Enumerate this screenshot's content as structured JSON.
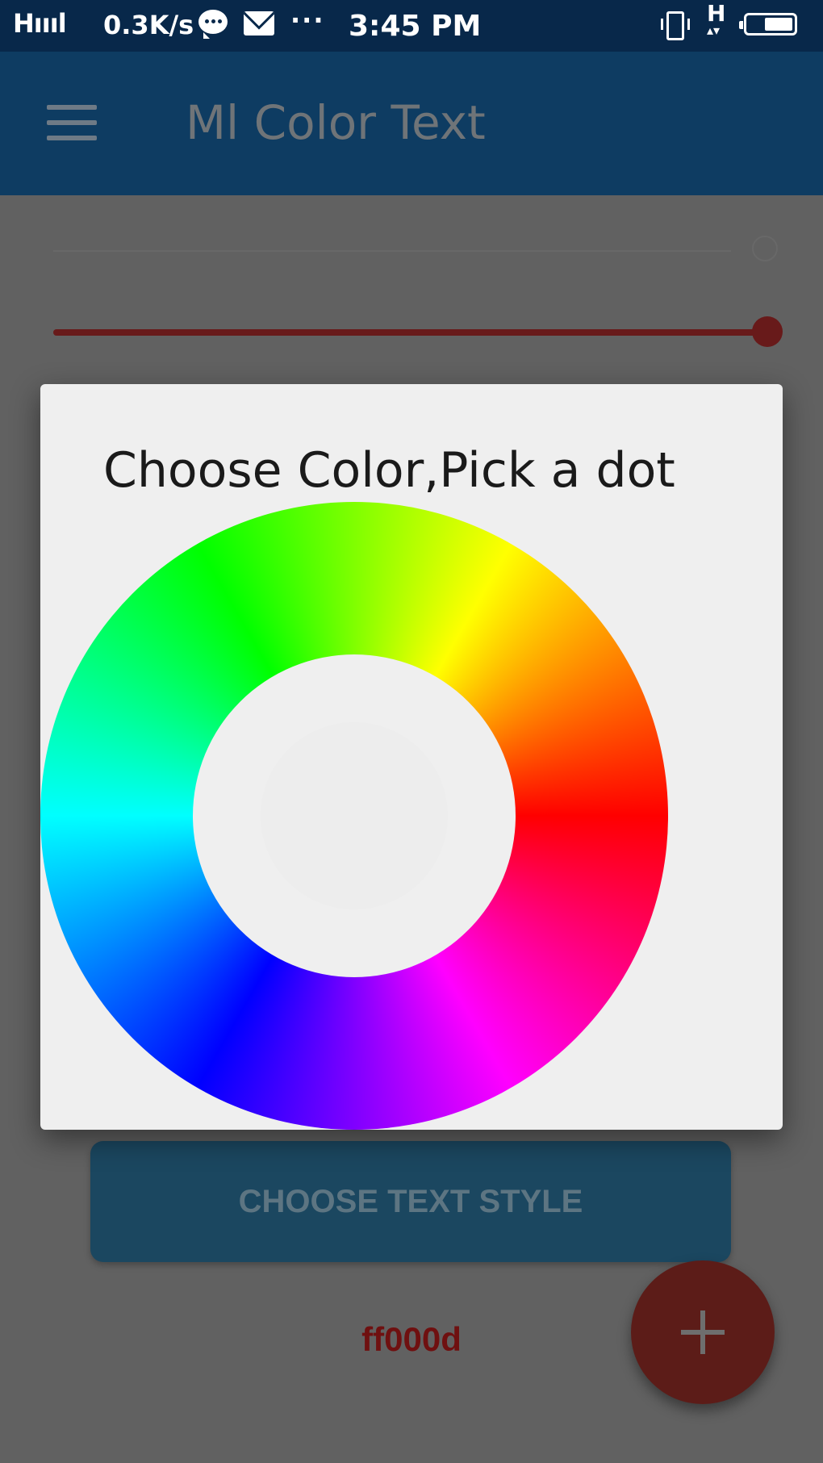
{
  "status_bar": {
    "signal": "H",
    "speed": "0.3K/s",
    "overflow": "···",
    "time": "3:45 PM",
    "network_type": "H",
    "icons": [
      "signal-icon",
      "chat-icon",
      "mail-icon",
      "vibrate-icon",
      "battery-icon"
    ]
  },
  "app_bar": {
    "title": "Ml Color Text",
    "menu_icon": "hamburger-menu-icon"
  },
  "dialog": {
    "title": "Choose Color,Pick a dot"
  },
  "main": {
    "style_button_label": "CHOOSE TEXT STYLE",
    "color_hex": "ff000d",
    "fab_icon": "plus-icon",
    "slider_value_fraction": 1.0
  },
  "colors": {
    "status_bar": "#08284a",
    "app_bar": "#0e3c62",
    "scrim": "#616161",
    "accent_dimmed": "#681a1a",
    "selected_color": "#ff000d"
  }
}
